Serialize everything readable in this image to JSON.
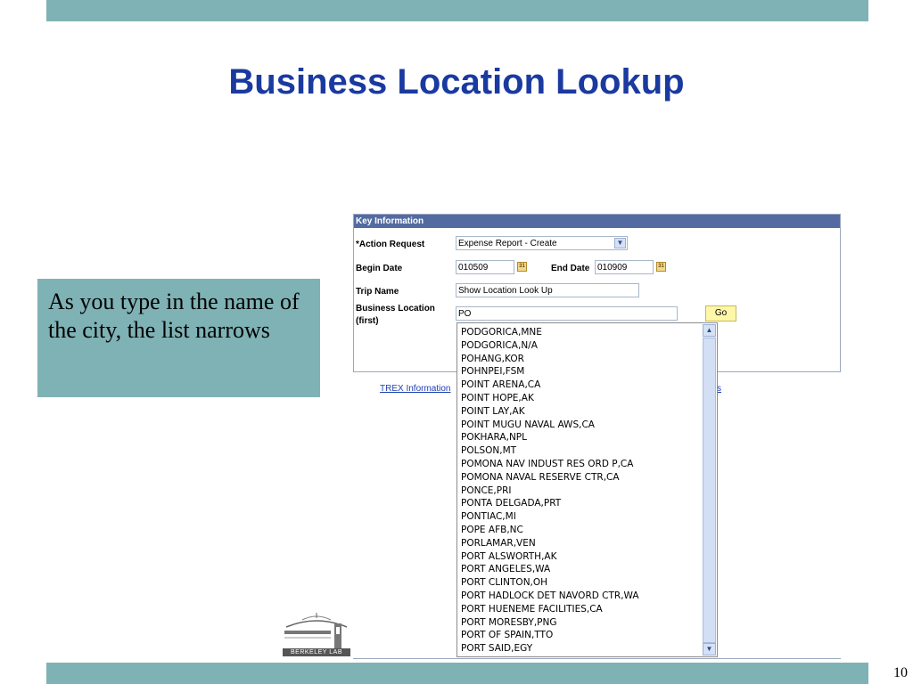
{
  "slide": {
    "title": "Business Location Lookup",
    "page_number": "10",
    "callout_text": "As you type in the name of the city, the list narrows",
    "logo_text": "BERKELEY LAB"
  },
  "form": {
    "section_header": "Key Information",
    "action_request_label": "*Action Request",
    "action_request_value": "Expense Report - Create",
    "begin_date_label": "Begin Date",
    "begin_date_value": "010509",
    "end_date_label": "End Date",
    "end_date_value": "010909",
    "trip_name_label": "Trip Name",
    "trip_name_value": "Show Location Look Up",
    "business_location_label_line1": "Business Location",
    "business_location_label_line2": "(first)",
    "business_location_value": "PO",
    "go_button_label": "Go",
    "calendar_icon_text": "31"
  },
  "links": {
    "left_link_text": "TREX Information",
    "right_link_text": "s"
  },
  "dropdown": {
    "options": [
      "PODGORICA,MNE",
      "PODGORICA,N/A",
      "POHANG,KOR",
      "POHNPEI,FSM",
      "POINT ARENA,CA",
      "POINT HOPE,AK",
      "POINT LAY,AK",
      "POINT MUGU NAVAL AWS,CA",
      "POKHARA,NPL",
      "POLSON,MT",
      "POMONA NAV INDUST RES ORD P,CA",
      "POMONA NAVAL RESERVE CTR,CA",
      "PONCE,PRI",
      "PONTA DELGADA,PRT",
      "PONTIAC,MI",
      "POPE AFB,NC",
      "PORLAMAR,VEN",
      "PORT ALSWORTH,AK",
      "PORT ANGELES,WA",
      "PORT CLINTON,OH",
      "PORT HADLOCK DET NAVORD CTR,WA",
      "PORT HUENEME FACILITIES,CA",
      "PORT MORESBY,PNG",
      "PORT OF SPAIN,TTO",
      "PORT SAID,EGY"
    ]
  },
  "colors": {
    "slide_band": "#7fb2b5",
    "title_blue": "#1a3aa0",
    "panel_header": "#536ba1",
    "go_button": "#fff7a8",
    "link_blue": "#1d3fb0"
  },
  "icons": {
    "select_arrow": "chevron-down-icon",
    "calendar": "calendar-icon",
    "scroll_up": "chevron-up-icon",
    "scroll_down": "chevron-down-icon",
    "logo": "berkeley-lab-logo"
  }
}
